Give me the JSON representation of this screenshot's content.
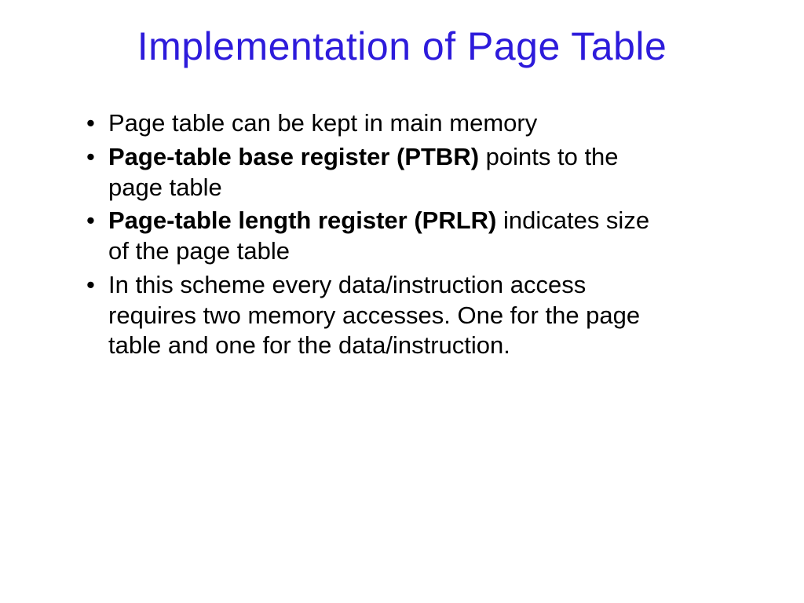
{
  "title": "Implementation of Page Table",
  "bullets": {
    "b1": "Page table can be kept in main memory",
    "b2_bold": "Page-table base register (PTBR)",
    "b2_rest": " points to the page table",
    "b3_bold": "Page-table length register (PRLR)",
    "b3_rest": " indicates size of the page table",
    "b4": "In this scheme every data/instruction access requires two memory accesses.  One for the page table and one for the data/instruction."
  }
}
